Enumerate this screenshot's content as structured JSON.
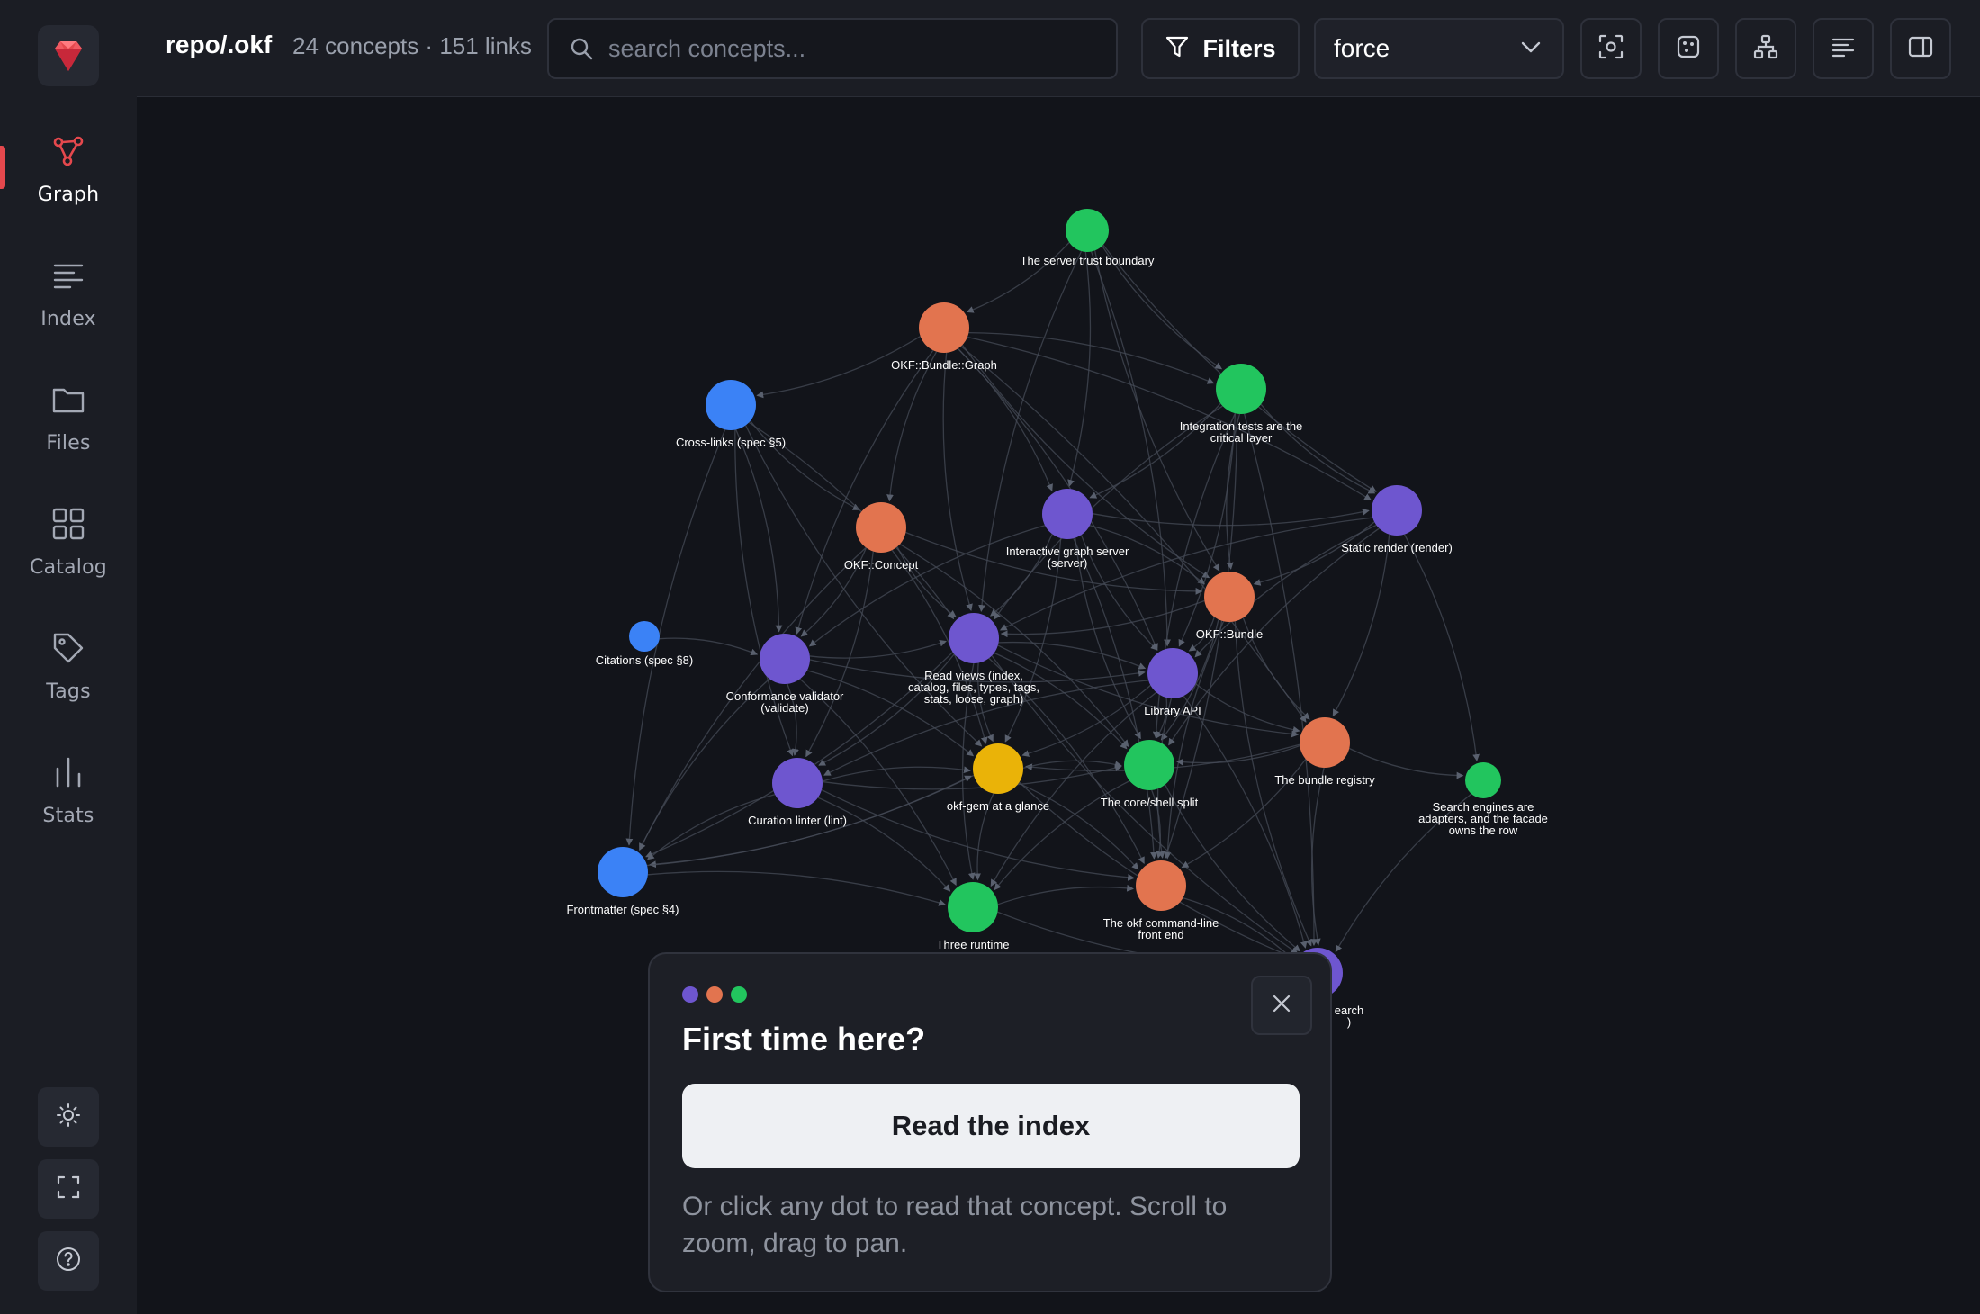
{
  "app": {
    "repo": "repo/.okf",
    "meta": "24 concepts · 151 links"
  },
  "nav": [
    {
      "label": "Graph",
      "icon": "graph-icon",
      "active": true
    },
    {
      "label": "Index",
      "icon": "list-icon",
      "active": false
    },
    {
      "label": "Files",
      "icon": "folder-icon",
      "active": false
    },
    {
      "label": "Catalog",
      "icon": "grid-icon",
      "active": false
    },
    {
      "label": "Tags",
      "icon": "tag-icon",
      "active": false
    },
    {
      "label": "Stats",
      "icon": "bar-chart-icon",
      "active": false
    }
  ],
  "rail_buttons": [
    "sun-icon",
    "fullscreen-icon",
    "help-icon"
  ],
  "search": {
    "placeholder": "search concepts..."
  },
  "filters": {
    "label": "Filters"
  },
  "layout": {
    "selected": "force"
  },
  "toolbar_icons": [
    "focus-icon",
    "cluster-icon",
    "hierarchy-icon",
    "text-align-icon",
    "panel-toggle-icon"
  ],
  "colors": {
    "accent": "#e5484d",
    "purple": "#6e56cf",
    "orange": "#e2744f",
    "green": "#22c55e",
    "blue": "#3b82f6",
    "yellow": "#eab308"
  },
  "graph": {
    "nodes": [
      {
        "id": "n1",
        "label": [
          "The server trust boundary"
        ],
        "color": "green"
      },
      {
        "id": "n2",
        "label": [
          "OKF::Bundle::Graph"
        ],
        "color": "orange"
      },
      {
        "id": "n3",
        "label": [
          "Cross-links (spec §5)"
        ],
        "color": "blue"
      },
      {
        "id": "n4",
        "label": [
          "Integration tests are the",
          "critical layer"
        ],
        "color": "green"
      },
      {
        "id": "n5",
        "label": [
          "OKF::Concept"
        ],
        "color": "orange"
      },
      {
        "id": "n6",
        "label": [
          "Interactive graph server",
          "(server)"
        ],
        "color": "purple"
      },
      {
        "id": "n7",
        "label": [
          "Static render (render)"
        ],
        "color": "purple"
      },
      {
        "id": "n8",
        "label": [
          "OKF::Bundle"
        ],
        "color": "orange"
      },
      {
        "id": "n9",
        "label": [
          "Citations (spec §8)"
        ],
        "color": "blue"
      },
      {
        "id": "n10",
        "label": [
          "Conformance validator",
          "(validate)"
        ],
        "color": "purple"
      },
      {
        "id": "n11",
        "label": [
          "Read views (index,",
          "catalog, files, types, tags,",
          "stats, loose, graph)"
        ],
        "color": "purple"
      },
      {
        "id": "n12",
        "label": [
          "Library API"
        ],
        "color": "purple"
      },
      {
        "id": "n13",
        "label": [
          "The bundle registry"
        ],
        "color": "orange"
      },
      {
        "id": "n14",
        "label": [
          "Search engines are",
          "adapters, and the facade",
          "owns the row"
        ],
        "color": "green"
      },
      {
        "id": "n15",
        "label": [
          "Curation linter (lint)"
        ],
        "color": "purple"
      },
      {
        "id": "n16",
        "label": [
          "okf-gem at a glance"
        ],
        "color": "yellow"
      },
      {
        "id": "n17",
        "label": [
          "The core/shell split"
        ],
        "color": "green"
      },
      {
        "id": "n18",
        "label": [
          "Frontmatter (spec §4)"
        ],
        "color": "blue"
      },
      {
        "id": "n19",
        "label": [
          "Three runtime"
        ],
        "color": "green"
      },
      {
        "id": "n20",
        "label": [
          "The okf command-line",
          "front end"
        ],
        "color": "orange"
      },
      {
        "id": "n21",
        "label": [
          "earch",
          ")"
        ],
        "color": "purple"
      }
    ]
  },
  "onboarding": {
    "title": "First time here?",
    "cta": "Read the index",
    "text": "Or click any dot to read that concept. Scroll to zoom, drag to pan."
  }
}
